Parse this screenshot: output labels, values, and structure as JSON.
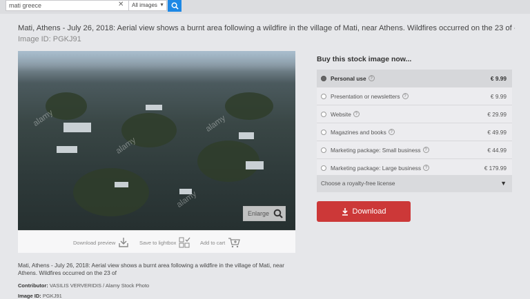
{
  "search": {
    "value": "mati greece",
    "clear_icon": "close-icon",
    "filter_label": "All images",
    "search_icon": "search-icon"
  },
  "page": {
    "title": "Mati, Athens - July 26, 2018: Aerial view shows a burnt area following a wildfire in the village of Mati, near Athens. Wildfires occurred on the 23 of -",
    "image_id_line": "Image ID: PGKJ91"
  },
  "preview": {
    "watermark": "alamy",
    "enlarge_label": "Enlarge",
    "actions": [
      {
        "label": "Download preview",
        "icon": "download-icon"
      },
      {
        "label": "Save to lightbox",
        "icon": "lightbox-icon"
      },
      {
        "label": "Add to cart",
        "icon": "cart-icon"
      }
    ]
  },
  "details": {
    "description": "Mati, Athens - July 26, 2018: Aerial view shows a burnt area following a wildfire in the village of Mati, near Athens. Wildfires occurred on the 23 of",
    "contributor_label": "Contributor:",
    "contributor_value": "VASILIS VERVERIDIS / Alamy Stock Photo",
    "image_id_label": "Image ID:",
    "image_id_value": "PGKJ91"
  },
  "buy": {
    "title": "Buy this stock image now...",
    "licenses": [
      {
        "label": "Personal use",
        "price": "€ 9.99",
        "selected": true
      },
      {
        "label": "Presentation or newsletters",
        "price": "€ 9.99",
        "selected": false
      },
      {
        "label": "Website",
        "price": "€ 29.99",
        "selected": false
      },
      {
        "label": "Magazines and books",
        "price": "€ 49.99",
        "selected": false
      },
      {
        "label": "Marketing package: Small business",
        "price": "€ 44.99",
        "selected": false
      },
      {
        "label": "Marketing package: Large business",
        "price": "€ 179.99",
        "selected": false
      }
    ],
    "royalty_free_label": "Choose a royalty-free license",
    "download_label": "Download",
    "download_icon": "download-arrow-icon"
  },
  "colors": {
    "accent_blue": "#1e88e5",
    "download_red": "#cc3838"
  }
}
